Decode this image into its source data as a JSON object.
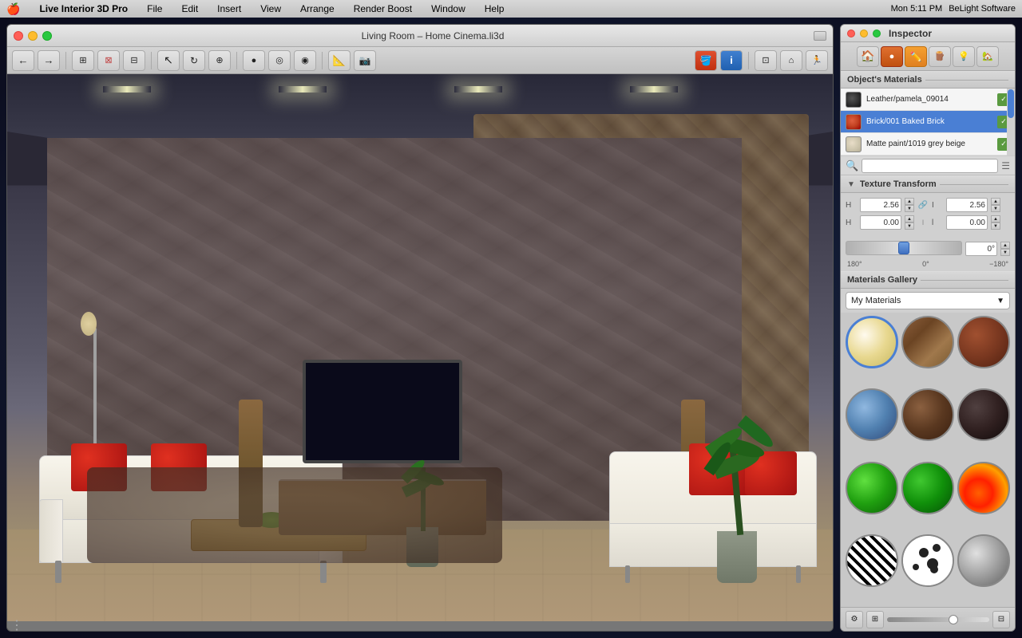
{
  "menubar": {
    "apple": "🍎",
    "app_name": "Live Interior 3D Pro",
    "menus": [
      "File",
      "Edit",
      "Insert",
      "View",
      "Arrange",
      "Render Boost",
      "Window",
      "Help"
    ],
    "right_items": [
      "Mon 5:11 PM",
      "BeLight Software"
    ]
  },
  "window": {
    "title": "Living Room – Home Cinema.li3d",
    "close_label": "",
    "min_label": "",
    "max_label": ""
  },
  "inspector": {
    "title": "Inspector",
    "tabs": [
      {
        "id": "object",
        "icon": "🏠",
        "active": false
      },
      {
        "id": "material_ball",
        "icon": "●",
        "active": false
      },
      {
        "id": "pencil",
        "icon": "✏️",
        "active": true
      },
      {
        "id": "wood",
        "icon": "🪵",
        "active": false
      },
      {
        "id": "bulb",
        "icon": "💡",
        "active": false
      },
      {
        "id": "house2",
        "icon": "🏡",
        "active": false
      }
    ],
    "section_objects_materials": "Object's Materials",
    "materials": [
      {
        "name": "Leather/pamela_09014",
        "swatch": "dark_gray",
        "has_icon": true,
        "selected": false
      },
      {
        "name": "Brick/001 Baked Brick",
        "swatch": "red",
        "has_icon": true,
        "selected": false
      },
      {
        "name": "Matte paint/1019 grey beige",
        "swatch": "tan",
        "has_icon": true,
        "selected": false
      }
    ],
    "filter_placeholder": "🔍",
    "texture_transform": {
      "title": "Texture Transform",
      "row1_label_x": "H",
      "row1_value_x": "2.56",
      "row1_label_y": "I",
      "row1_value_y": "2.56",
      "row2_label_x": "H",
      "row2_value_x": "0.00",
      "row2_label_y": "l",
      "row2_value_y": "0.00"
    },
    "angle": {
      "left_label": "180°",
      "center_label": "0°",
      "right_label": "−180°",
      "value_label": "0°"
    },
    "gallery": {
      "section_title": "Materials Gallery",
      "dropdown_value": "My Materials",
      "items": [
        {
          "id": "ivory",
          "class": "mat-ivory",
          "selected": true
        },
        {
          "id": "wood1",
          "class": "mat-wood1",
          "selected": false
        },
        {
          "id": "brick",
          "class": "mat-brick",
          "selected": false
        },
        {
          "id": "water",
          "class": "mat-water",
          "selected": false
        },
        {
          "id": "brown",
          "class": "mat-brown",
          "selected": false
        },
        {
          "id": "dark",
          "class": "mat-dark",
          "selected": false
        },
        {
          "id": "green1",
          "class": "mat-green1",
          "selected": false
        },
        {
          "id": "green2",
          "class": "mat-green2",
          "selected": false
        },
        {
          "id": "fire",
          "class": "mat-fire",
          "selected": false
        },
        {
          "id": "zebra",
          "class": "mat-zebra",
          "selected": false
        },
        {
          "id": "spots",
          "class": "mat-spots",
          "selected": false
        },
        {
          "id": "metal",
          "class": "mat-metal",
          "selected": false
        }
      ]
    },
    "bottom_toolbar": {
      "gear_btn": "⚙",
      "export_btn": "⊞",
      "import_btn": "⊟"
    }
  }
}
